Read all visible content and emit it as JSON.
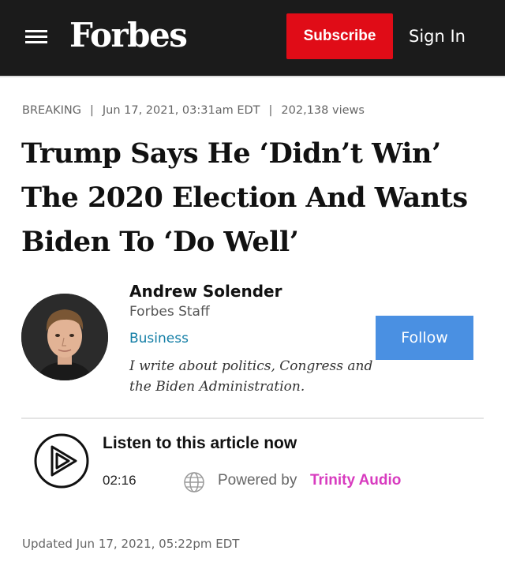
{
  "header": {
    "logo_text": "Forbes",
    "subscribe_label": "Subscribe",
    "signin_label": "Sign In",
    "menu_icon": "hamburger-menu-icon"
  },
  "article_meta": {
    "label": "BREAKING",
    "date": "Jun 17, 2021, 03:31am EDT",
    "views": "202,138 views"
  },
  "headline": "Trump Says He ‘Didn’t Win’ The 2020 Election And Wants Biden To ‘Do Well’",
  "author": {
    "name": "Andrew Solender",
    "role": "Forbes Staff",
    "section": "Business",
    "bio": "I write about politics, Congress and the Biden Administration.",
    "follow_label": "Follow"
  },
  "audio": {
    "title": "Listen to this article now",
    "duration": "02:16",
    "powered_by": "Powered by",
    "provider": "Trinity Audio",
    "icon": "play-circle-icon"
  },
  "updated": "Updated Jun 17, 2021, 05:22pm EDT",
  "colors": {
    "header_bg": "#1b1b1b",
    "subscribe_bg": "#e00c17",
    "follow_bg": "#4a90e2",
    "section_link": "#137ea6",
    "provider_link": "#d83bbf"
  }
}
